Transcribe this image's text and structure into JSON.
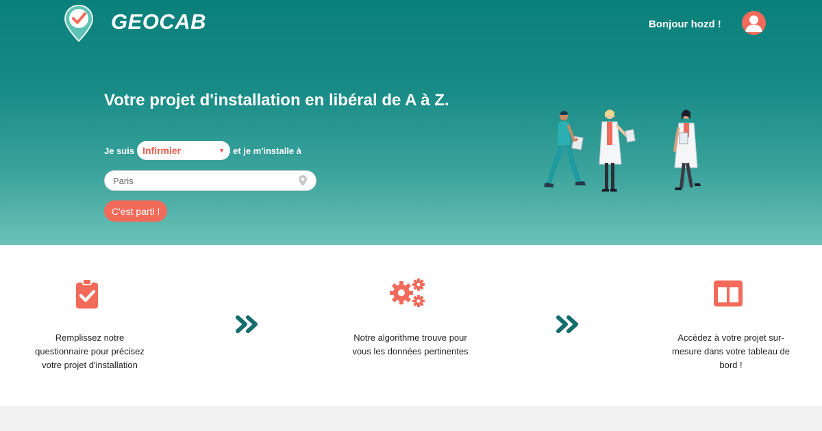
{
  "header": {
    "brand": "GEOCAB",
    "greeting": "Bonjour hozd !",
    "logo_icon": "map-pin-check-icon",
    "avatar_icon": "user-avatar-icon"
  },
  "hero": {
    "headline": "Votre projet d'installation en libéral de A à Z.",
    "prefix": "Je suis",
    "profession_selected": "Infirmier",
    "suffix": "et je m'installe à",
    "city_placeholder": "Paris",
    "cta": "C'est parti !"
  },
  "steps": [
    {
      "icon": "clipboard-check-icon",
      "text": "Remplissez notre questionnaire pour précisez votre projet d'installation"
    },
    {
      "icon": "gears-icon",
      "text": "Notre algorithme trouve pour vous les données pertinentes"
    },
    {
      "icon": "dashboard-columns-icon",
      "text": "Accédez à votre projet sur-mesure dans votre tableau de bord !"
    }
  ],
  "colors": {
    "accent": "#f26a5a",
    "teal": "#0a807b",
    "dark_teal": "#146d6c"
  }
}
